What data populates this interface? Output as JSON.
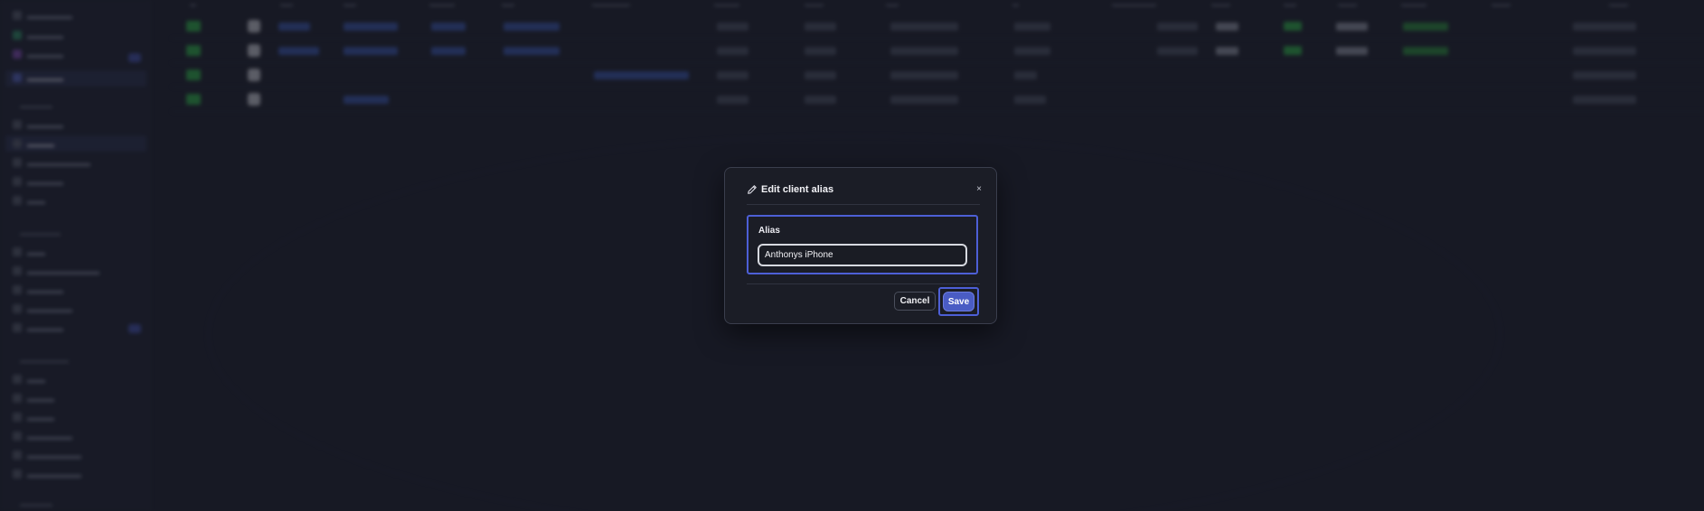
{
  "dialog": {
    "title": "Edit client alias",
    "title_icon": "pencil-icon",
    "close_label": "×",
    "field_label": "Alias",
    "alias_value": "Anthonys iPhone",
    "cancel_label": "Cancel",
    "save_label": "Save"
  },
  "colors": {
    "accent": "#4d5fd6",
    "save_button": "#4a5cc4",
    "background": "#1b1e2a",
    "dialog_background": "#1b1d26"
  }
}
